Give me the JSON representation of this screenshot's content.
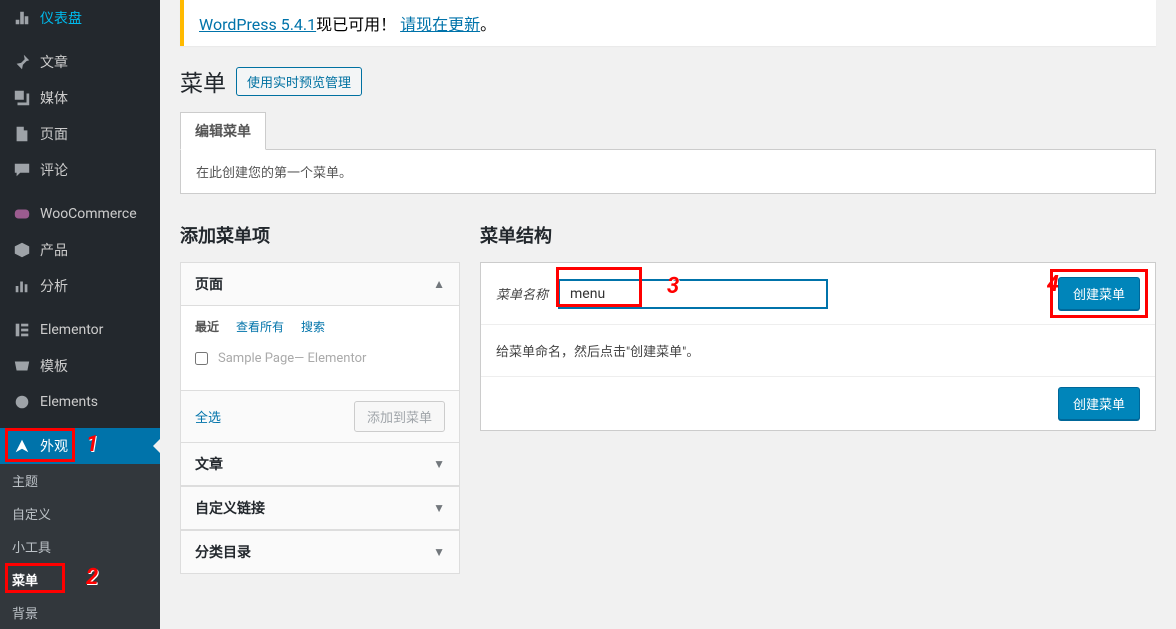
{
  "sidebar": {
    "items": [
      {
        "label": "仪表盘",
        "icon": "dashboard"
      },
      {
        "label": "文章",
        "icon": "pin"
      },
      {
        "label": "媒体",
        "icon": "media"
      },
      {
        "label": "页面",
        "icon": "page"
      },
      {
        "label": "评论",
        "icon": "comment"
      },
      {
        "label": "WooCommerce",
        "icon": "woo"
      },
      {
        "label": "产品",
        "icon": "product"
      },
      {
        "label": "分析",
        "icon": "analytics"
      },
      {
        "label": "Elementor",
        "icon": "elementor"
      },
      {
        "label": "模板",
        "icon": "templates"
      },
      {
        "label": "Elements",
        "icon": "elements"
      },
      {
        "label": "外观",
        "icon": "appearance"
      }
    ],
    "sub": [
      {
        "label": "主题"
      },
      {
        "label": "自定义"
      },
      {
        "label": "小工具"
      },
      {
        "label": "菜单"
      },
      {
        "label": "背景"
      }
    ]
  },
  "annotations": {
    "n1": "1",
    "n2": "2",
    "n3": "3",
    "n4": "4"
  },
  "notice": {
    "prefix": "WordPress 5.4.1",
    "mid": "现已可用！",
    "link": "请现在更新",
    "suffix": "。"
  },
  "page": {
    "title": "菜单",
    "preview_btn": "使用实时预览管理",
    "tab_edit": "编辑菜单",
    "info": "在此创建您的第一个菜单。"
  },
  "add_section": {
    "heading": "添加菜单项",
    "pages": {
      "title": "页面",
      "tabs": {
        "recent": "最近",
        "all": "查看所有",
        "search": "搜索"
      },
      "item": {
        "name": "Sample Page",
        "suffix": " — Elementor"
      },
      "select_all": "全选",
      "add_btn": "添加到菜单"
    },
    "acc2": "文章",
    "acc3": "自定义链接",
    "acc4": "分类目录"
  },
  "structure": {
    "heading": "菜单结构",
    "name_label": "菜单名称",
    "name_value": "menu",
    "create_btn": "创建菜单",
    "hint": "给菜单命名，然后点击\"创建菜单\"。",
    "footer_btn": "创建菜单"
  }
}
